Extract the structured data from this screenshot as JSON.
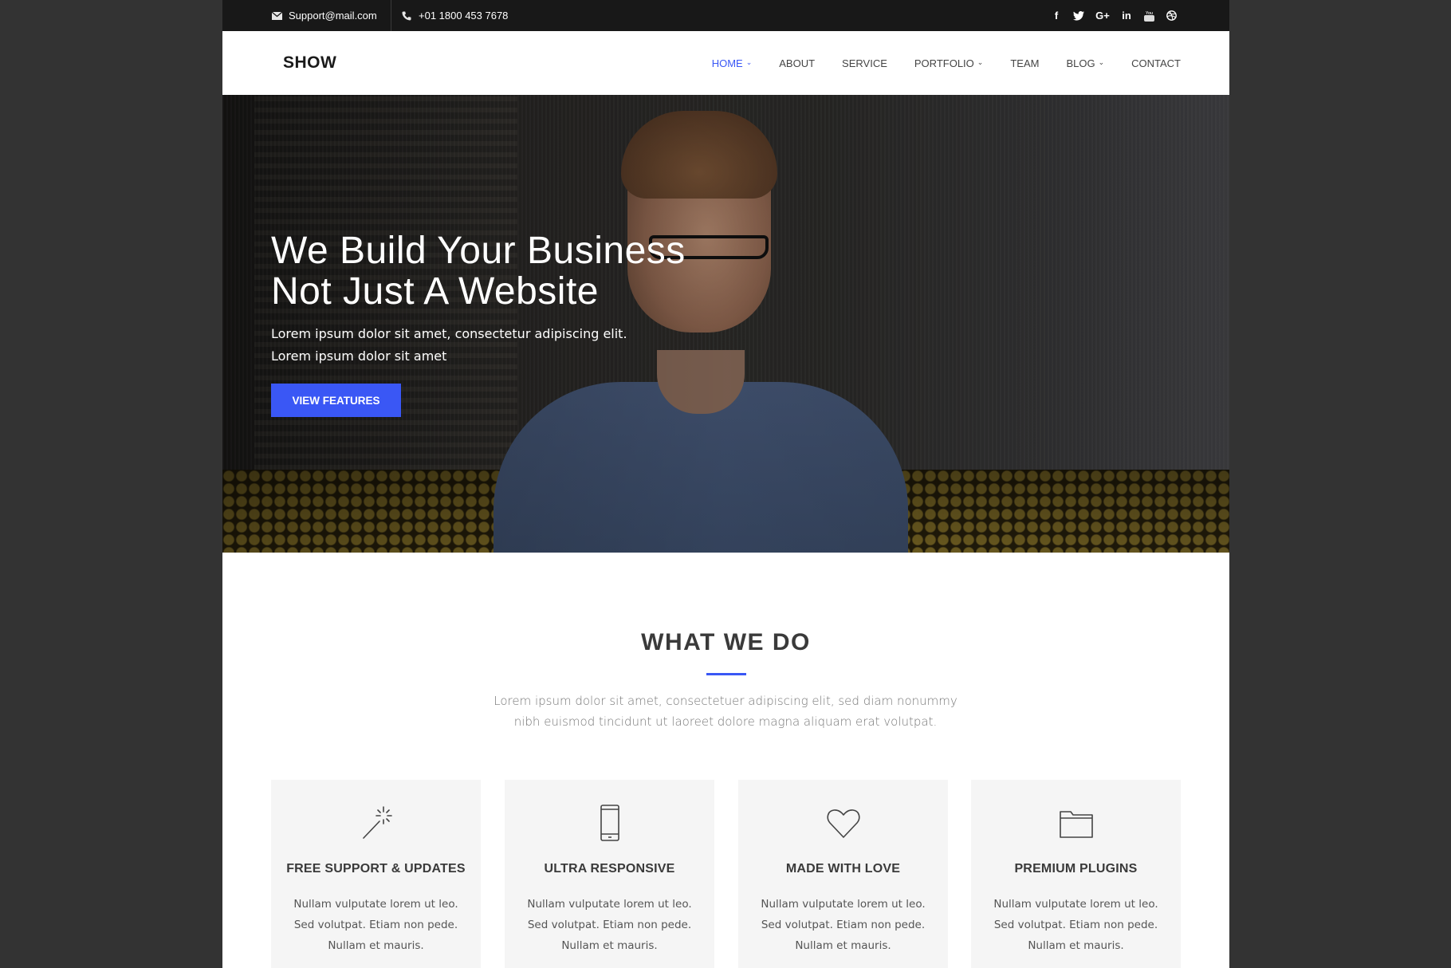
{
  "topbar": {
    "email": "Support@mail.com",
    "phone": "+01 1800 453 7678",
    "social": [
      "facebook",
      "twitter",
      "google-plus",
      "linkedin",
      "youtube",
      "dribbble"
    ]
  },
  "header": {
    "logo": "SHOW",
    "nav": [
      {
        "label": "HOME",
        "dropdown": true,
        "active": true
      },
      {
        "label": "ABOUT",
        "dropdown": false,
        "active": false
      },
      {
        "label": "SERVICE",
        "dropdown": false,
        "active": false
      },
      {
        "label": "PORTFOLIO",
        "dropdown": true,
        "active": false
      },
      {
        "label": "TEAM",
        "dropdown": false,
        "active": false
      },
      {
        "label": "BLOG",
        "dropdown": true,
        "active": false
      },
      {
        "label": "CONTACT",
        "dropdown": false,
        "active": false
      }
    ]
  },
  "hero": {
    "title_line1": "We Build Your Business",
    "title_line2": "Not Just A Website",
    "subtitle_line1": "Lorem ipsum dolor sit amet, consectetur adipiscing elit.",
    "subtitle_line2": "Lorem ipsum dolor sit amet",
    "cta": "VIEW FEATURES"
  },
  "features": {
    "title": "WHAT WE DO",
    "lead_line1": "Lorem ipsum dolor sit amet, consectetuer adipiscing elit, sed diam nonummy",
    "lead_line2": "nibh euismod tincidunt ut laoreet dolore magna aliquam erat volutpat.",
    "cards": [
      {
        "icon": "magic-wand-icon",
        "title": "FREE SUPPORT & UPDATES",
        "lines": [
          "Nullam vulputate lorem ut leo.",
          "Sed volutpat. Etiam non pede.",
          "Nullam et mauris."
        ]
      },
      {
        "icon": "mobile-phone-icon",
        "title": "ULTRA RESPONSIVE",
        "lines": [
          "Nullam vulputate lorem ut leo.",
          "Sed volutpat. Etiam non pede.",
          "Nullam et mauris."
        ]
      },
      {
        "icon": "heart-icon",
        "title": "MADE WITH LOVE",
        "lines": [
          "Nullam vulputate lorem ut leo.",
          "Sed volutpat. Etiam non pede.",
          "Nullam et mauris."
        ]
      },
      {
        "icon": "folder-icon",
        "title": "PREMIUM PLUGINS",
        "lines": [
          "Nullam vulputate lorem ut leo.",
          "Sed volutpat. Etiam non pede.",
          "Nullam et mauris."
        ]
      }
    ]
  },
  "colors": {
    "accent": "#3a57f5",
    "topbar_bg": "#181818",
    "page_bg": "#333333",
    "card_bg": "#f5f5f5"
  }
}
